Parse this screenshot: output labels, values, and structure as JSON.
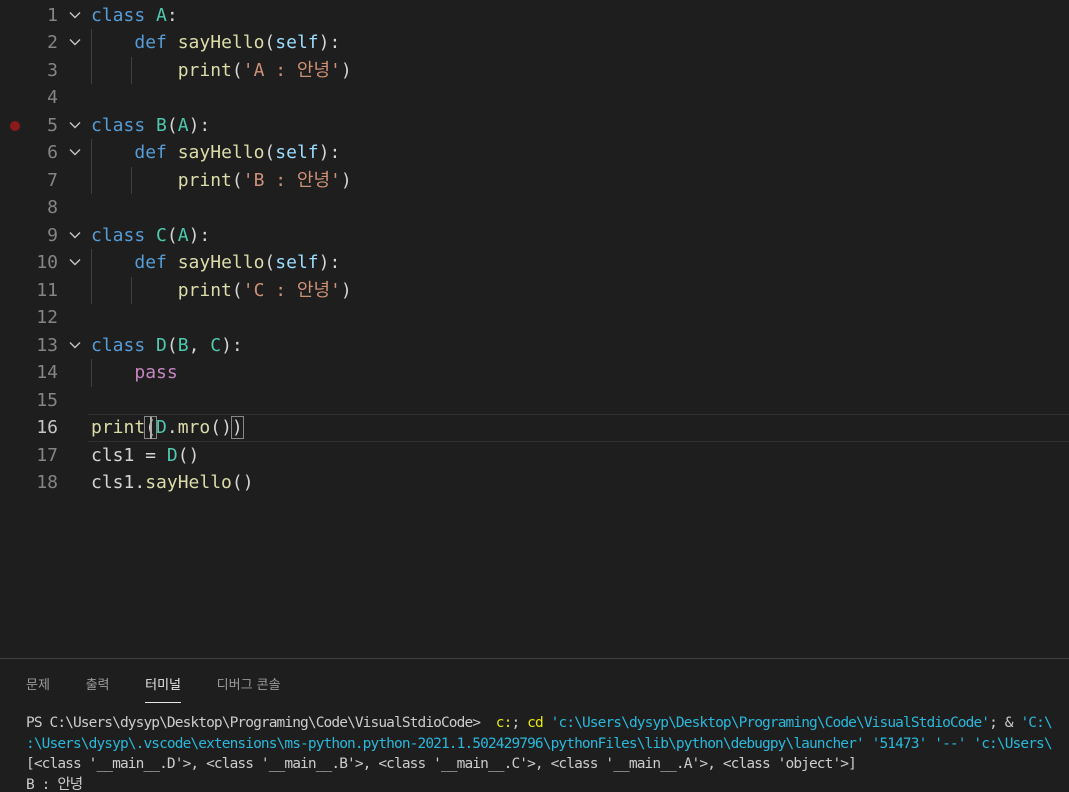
{
  "editor": {
    "active_line": 16,
    "breakpoint_line": 5,
    "lines": [
      {
        "n": "1",
        "tokens": [
          [
            "kw",
            "class"
          ],
          [
            "pl",
            " "
          ],
          [
            "cls",
            "A"
          ],
          [
            "pl",
            ":"
          ]
        ],
        "fold": true
      },
      {
        "n": "2",
        "tokens": [
          [
            "pl",
            "    "
          ],
          [
            "kw",
            "def"
          ],
          [
            "pl",
            " "
          ],
          [
            "fn",
            "sayHello"
          ],
          [
            "pl",
            "("
          ],
          [
            "prm",
            "self"
          ],
          [
            "pl",
            "):"
          ]
        ],
        "fold": true
      },
      {
        "n": "3",
        "tokens": [
          [
            "pl",
            "        "
          ],
          [
            "fn",
            "print"
          ],
          [
            "pl",
            "("
          ],
          [
            "str",
            "'A : 안녕'"
          ],
          [
            "pl",
            ")"
          ]
        ]
      },
      {
        "n": "4",
        "tokens": []
      },
      {
        "n": "5",
        "tokens": [
          [
            "kw",
            "class"
          ],
          [
            "pl",
            " "
          ],
          [
            "cls",
            "B"
          ],
          [
            "pl",
            "("
          ],
          [
            "cls",
            "A"
          ],
          [
            "pl",
            "):"
          ]
        ],
        "fold": true
      },
      {
        "n": "6",
        "tokens": [
          [
            "pl",
            "    "
          ],
          [
            "kw",
            "def"
          ],
          [
            "pl",
            " "
          ],
          [
            "fn",
            "sayHello"
          ],
          [
            "pl",
            "("
          ],
          [
            "prm",
            "self"
          ],
          [
            "pl",
            "):"
          ]
        ],
        "fold": true
      },
      {
        "n": "7",
        "tokens": [
          [
            "pl",
            "        "
          ],
          [
            "fn",
            "print"
          ],
          [
            "pl",
            "("
          ],
          [
            "str",
            "'B : 안녕'"
          ],
          [
            "pl",
            ")"
          ]
        ]
      },
      {
        "n": "8",
        "tokens": []
      },
      {
        "n": "9",
        "tokens": [
          [
            "kw",
            "class"
          ],
          [
            "pl",
            " "
          ],
          [
            "cls",
            "C"
          ],
          [
            "pl",
            "("
          ],
          [
            "cls",
            "A"
          ],
          [
            "pl",
            "):"
          ]
        ],
        "fold": true
      },
      {
        "n": "10",
        "tokens": [
          [
            "pl",
            "    "
          ],
          [
            "kw",
            "def"
          ],
          [
            "pl",
            " "
          ],
          [
            "fn",
            "sayHello"
          ],
          [
            "pl",
            "("
          ],
          [
            "prm",
            "self"
          ],
          [
            "pl",
            "):"
          ]
        ],
        "fold": true
      },
      {
        "n": "11",
        "tokens": [
          [
            "pl",
            "        "
          ],
          [
            "fn",
            "print"
          ],
          [
            "pl",
            "("
          ],
          [
            "str",
            "'C : 안녕'"
          ],
          [
            "pl",
            ")"
          ]
        ]
      },
      {
        "n": "12",
        "tokens": []
      },
      {
        "n": "13",
        "tokens": [
          [
            "kw",
            "class"
          ],
          [
            "pl",
            " "
          ],
          [
            "cls",
            "D"
          ],
          [
            "pl",
            "("
          ],
          [
            "cls",
            "B"
          ],
          [
            "pl",
            ", "
          ],
          [
            "cls",
            "C"
          ],
          [
            "pl",
            "):"
          ]
        ],
        "fold": true
      },
      {
        "n": "14",
        "tokens": [
          [
            "pl",
            "    "
          ],
          [
            "ctl",
            "pass"
          ]
        ]
      },
      {
        "n": "15",
        "tokens": []
      },
      {
        "n": "16",
        "tokens": [
          [
            "fn",
            "print"
          ],
          [
            "pl",
            "("
          ],
          [
            "cls",
            "D"
          ],
          [
            "pl",
            "."
          ],
          [
            "fn",
            "mro"
          ],
          [
            "pl",
            "()"
          ],
          [
            "pl",
            ")"
          ]
        ]
      },
      {
        "n": "17",
        "tokens": [
          [
            "pl",
            "cls1 = "
          ],
          [
            "cls",
            "D"
          ],
          [
            "pl",
            "()"
          ]
        ]
      },
      {
        "n": "18",
        "tokens": [
          [
            "pl",
            "cls1."
          ],
          [
            "fn",
            "sayHello"
          ],
          [
            "pl",
            "()"
          ]
        ]
      }
    ]
  },
  "panel": {
    "tabs": [
      {
        "label": "문제",
        "active": false
      },
      {
        "label": "출력",
        "active": false
      },
      {
        "label": "터미널",
        "active": true
      },
      {
        "label": "디버그 콘솔",
        "active": false
      }
    ],
    "terminal": [
      [
        [
          "t-white",
          "PS C:\\Users\\dysyp\\Desktop\\Programing\\Code\\VisualStdioCode>  "
        ],
        [
          "t-yellow",
          "c:"
        ],
        [
          "t-white",
          "; "
        ],
        [
          "t-yellow",
          "cd"
        ],
        [
          "t-white",
          " "
        ],
        [
          "t-blue",
          "'c:\\Users\\dysyp\\Desktop\\Programing\\Code\\VisualStdioCode'"
        ],
        [
          "t-white",
          "; & "
        ],
        [
          "t-blue",
          "'C:\\"
        ]
      ],
      [
        [
          "t-blue",
          ":\\Users\\dysyp\\.vscode\\extensions\\ms-python.python-2021.1.502429796\\pythonFiles\\lib\\python\\debugpy\\launcher' '51473' '--' 'c:\\Users\\"
        ]
      ],
      [
        [
          "t-white",
          "[<class '__main__.D'>, <class '__main__.B'>, <class '__main__.C'>, <class '__main__.A'>, <class 'object'>]"
        ]
      ],
      [
        [
          "t-white",
          "B : 안녕"
        ]
      ]
    ]
  }
}
